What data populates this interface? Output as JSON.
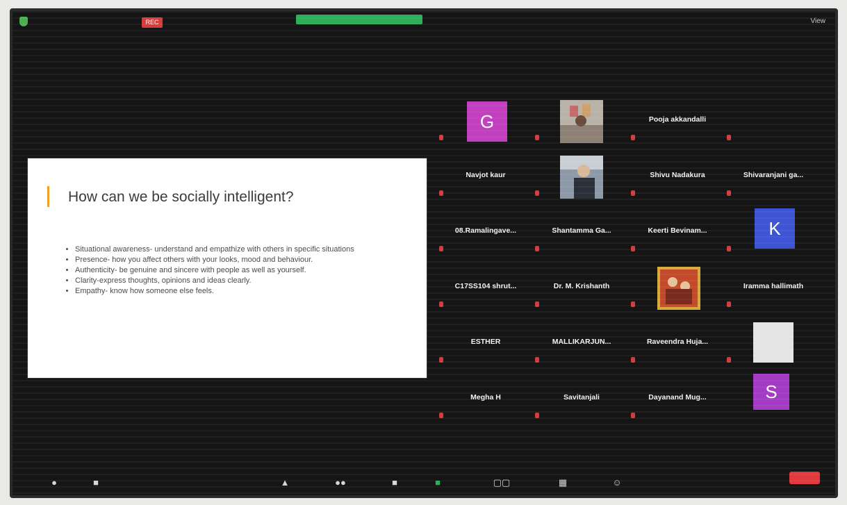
{
  "topbar": {
    "rec_label": "REC",
    "view_label": "View"
  },
  "slide": {
    "title": "How can we be socially intelligent?",
    "bullets": [
      "Situational awareness- understand and empathize with others in specific situations",
      "Presence- how you affect others with your looks, mood and behaviour.",
      "Authenticity- be genuine and sincere with people as well as yourself.",
      "Clarity-express thoughts, opinions and ideas clearly.",
      "Empathy- know how someone else feels."
    ]
  },
  "participants": {
    "r0c0": {
      "initial": "G",
      "color": "#c23fbf"
    },
    "r0c2": {
      "name": "Pooja akkandalli"
    },
    "r1c0": {
      "name": "Navjot kaur"
    },
    "r1c2": {
      "name": "Shivu Nadakura"
    },
    "r1c3": {
      "name": "Shivaranjani ga..."
    },
    "r2c0": {
      "name": "08.Ramalingave..."
    },
    "r2c1": {
      "name": "Shantamma Ga..."
    },
    "r2c2": {
      "name": "Keerti Bevinam..."
    },
    "r2c3": {
      "initial": "K",
      "color": "#3d55d4"
    },
    "r3c0": {
      "name": "C17SS104 shrut..."
    },
    "r3c1": {
      "name": "Dr. M. Krishanth"
    },
    "r3c3": {
      "name": "Iramma hallimath"
    },
    "r4c0": {
      "name": "ESTHER"
    },
    "r4c1": {
      "name": "MALLIKARJUN..."
    },
    "r4c2": {
      "name": "Raveendra Huja..."
    },
    "r5c0": {
      "name": "Megha H"
    },
    "r5c1": {
      "name": "Savitanjali"
    },
    "r5c2": {
      "name": "Dayanand Mug..."
    },
    "r5c3": {
      "initial": "S",
      "color": "#a43bc4"
    }
  },
  "colors": {
    "accent": "#f0a020",
    "end": "#e0393e"
  }
}
